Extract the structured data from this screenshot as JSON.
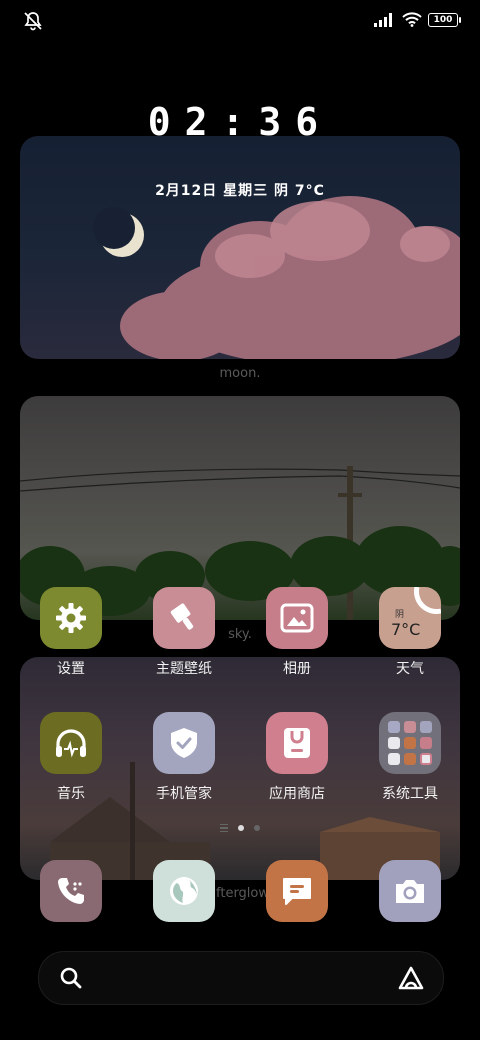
{
  "status_bar": {
    "mute_icon": "mute-bell-icon",
    "signal_icon": "signal-bars-icon",
    "wifi_icon": "wifi-icon",
    "battery_level": "100"
  },
  "clock": {
    "time": "02:36"
  },
  "date_weather": {
    "text": "2月12日  星期三  阴  7°C"
  },
  "widgets": [
    {
      "caption": "moon."
    },
    {
      "caption": "sky."
    },
    {
      "caption": "afterglow."
    }
  ],
  "apps_row1": [
    {
      "label": "设置",
      "icon": "gear-icon",
      "color": "#7e8a2f"
    },
    {
      "label": "主题壁纸",
      "icon": "brush-icon",
      "color": "#c98d96"
    },
    {
      "label": "相册",
      "icon": "gallery-icon",
      "color": "#c57e8a"
    },
    {
      "label": "天气",
      "icon": "weather-icon",
      "color": "#c8a090",
      "weather_condition": "阴",
      "weather_temp": "7°C"
    }
  ],
  "apps_row2": [
    {
      "label": "音乐",
      "icon": "headphones-icon",
      "color": "#6c6c22"
    },
    {
      "label": "手机管家",
      "icon": "shield-check-icon",
      "color": "#a3a4bd"
    },
    {
      "label": "应用商店",
      "icon": "store-bag-icon",
      "color": "#cf7f8e"
    },
    {
      "label": "系统工具",
      "icon": "folder-icon",
      "color": "#72707a"
    }
  ],
  "dock": [
    {
      "icon": "phone-icon",
      "color": "#8a6a72"
    },
    {
      "icon": "browser-globe-icon",
      "color": "#cfe0da"
    },
    {
      "icon": "messages-icon",
      "color": "#c27446"
    },
    {
      "icon": "camera-icon",
      "color": "#a2a1bd"
    }
  ],
  "pages": {
    "count": 2,
    "current": 1
  },
  "search_bar": {
    "left_icon": "search-icon",
    "right_icon": "assistant-icon"
  }
}
